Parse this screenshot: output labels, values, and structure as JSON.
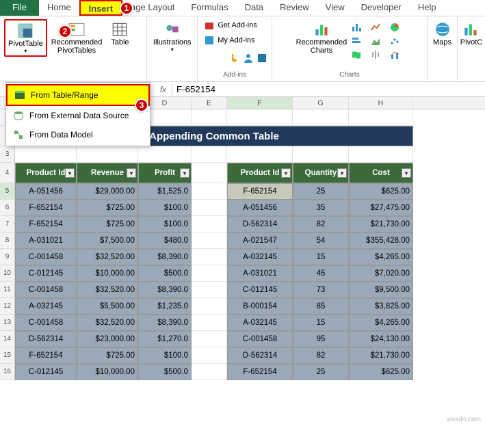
{
  "tabs": {
    "file": "File",
    "home": "Home",
    "insert": "Insert",
    "pagelayout": "age Layout",
    "formulas": "Formulas",
    "data": "Data",
    "review": "Review",
    "view": "View",
    "developer": "Developer",
    "help": "Help"
  },
  "ribbon": {
    "pivottable": "PivotTable",
    "recommended_pt": "Recommended\nPivotTables",
    "table": "Table",
    "illustrations": "Illustrations",
    "get_addins": "Get Add-ins",
    "my_addins": "My Add-ins",
    "addins_label": "Add-ins",
    "rec_charts": "Recommended\nCharts",
    "charts_label": "Charts",
    "maps": "Maps",
    "pivotc": "PivotC"
  },
  "dropdown": {
    "from_table": "From Table/Range",
    "from_external": "From External Data Source",
    "from_model": "From Data Model"
  },
  "formula": {
    "fx": "fx",
    "value": "F-652154"
  },
  "cols": [
    "",
    "",
    "",
    "D",
    "E",
    "F",
    "G",
    "H"
  ],
  "banner": "Appending Common Table",
  "left": {
    "headers": [
      "Product Id",
      "Revenue",
      "Profit"
    ],
    "rows": [
      [
        "A-051456",
        "$29,000.00",
        "$1,525.0"
      ],
      [
        "F-652154",
        "$725.00",
        "$100.0"
      ],
      [
        "F-652154",
        "$725.00",
        "$100.0"
      ],
      [
        "A-031021",
        "$7,500.00",
        "$480.0"
      ],
      [
        "C-001458",
        "$32,520.00",
        "$8,390.0"
      ],
      [
        "C-012145",
        "$10,000.00",
        "$500.0"
      ],
      [
        "C-001458",
        "$32,520.00",
        "$8,390.0"
      ],
      [
        "A-032145",
        "$5,500.00",
        "$1,235.0"
      ],
      [
        "C-001458",
        "$32,520.00",
        "$8,390.0"
      ],
      [
        "D-562314",
        "$23,000.00",
        "$1,270.0"
      ],
      [
        "F-652154",
        "$725.00",
        "$100.0"
      ],
      [
        "C-012145",
        "$10,000.00",
        "$500.0"
      ]
    ]
  },
  "right": {
    "headers": [
      "Product Id",
      "Quantity",
      "Cost"
    ],
    "rows": [
      [
        "F-652154",
        "25",
        "$625.00"
      ],
      [
        "A-051456",
        "35",
        "$27,475.00"
      ],
      [
        "D-562314",
        "82",
        "$21,730.00"
      ],
      [
        "A-021547",
        "54",
        "$355,428.00"
      ],
      [
        "A-032145",
        "15",
        "$4,265.00"
      ],
      [
        "A-031021",
        "45",
        "$7,020.00"
      ],
      [
        "C-012145",
        "73",
        "$9,500.00"
      ],
      [
        "B-000154",
        "85",
        "$3,825.00"
      ],
      [
        "A-032145",
        "15",
        "$4,265.00"
      ],
      [
        "C-001458",
        "95",
        "$24,130.00"
      ],
      [
        "D-562314",
        "82",
        "$21,730.00"
      ],
      [
        "F-652154",
        "25",
        "$625.00"
      ]
    ]
  },
  "watermark": "wsxdn.com"
}
